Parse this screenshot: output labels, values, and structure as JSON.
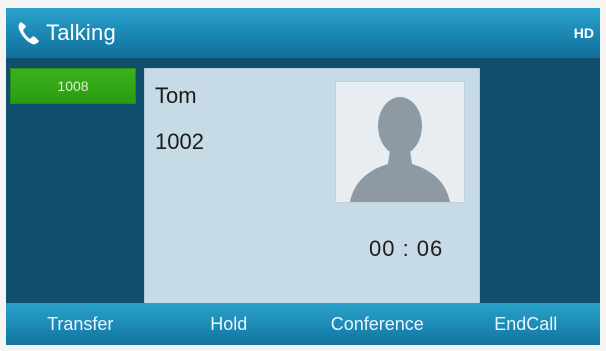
{
  "status": {
    "title": "Talking",
    "hd_label": "HD"
  },
  "line": {
    "label": "1008"
  },
  "call": {
    "name": "Tom",
    "number": "1002",
    "duration": "00 : 06"
  },
  "softkeys": {
    "transfer": "Transfer",
    "hold": "Hold",
    "conference": "Conference",
    "end_call": "EndCall"
  },
  "icons": {
    "status": "phone-handset-icon",
    "avatar": "person-silhouette-icon"
  },
  "colors": {
    "accent": "#1a86b2",
    "line_key": "#2b9b12",
    "background": "#0f4f6c",
    "card": "#c7dbe7"
  }
}
